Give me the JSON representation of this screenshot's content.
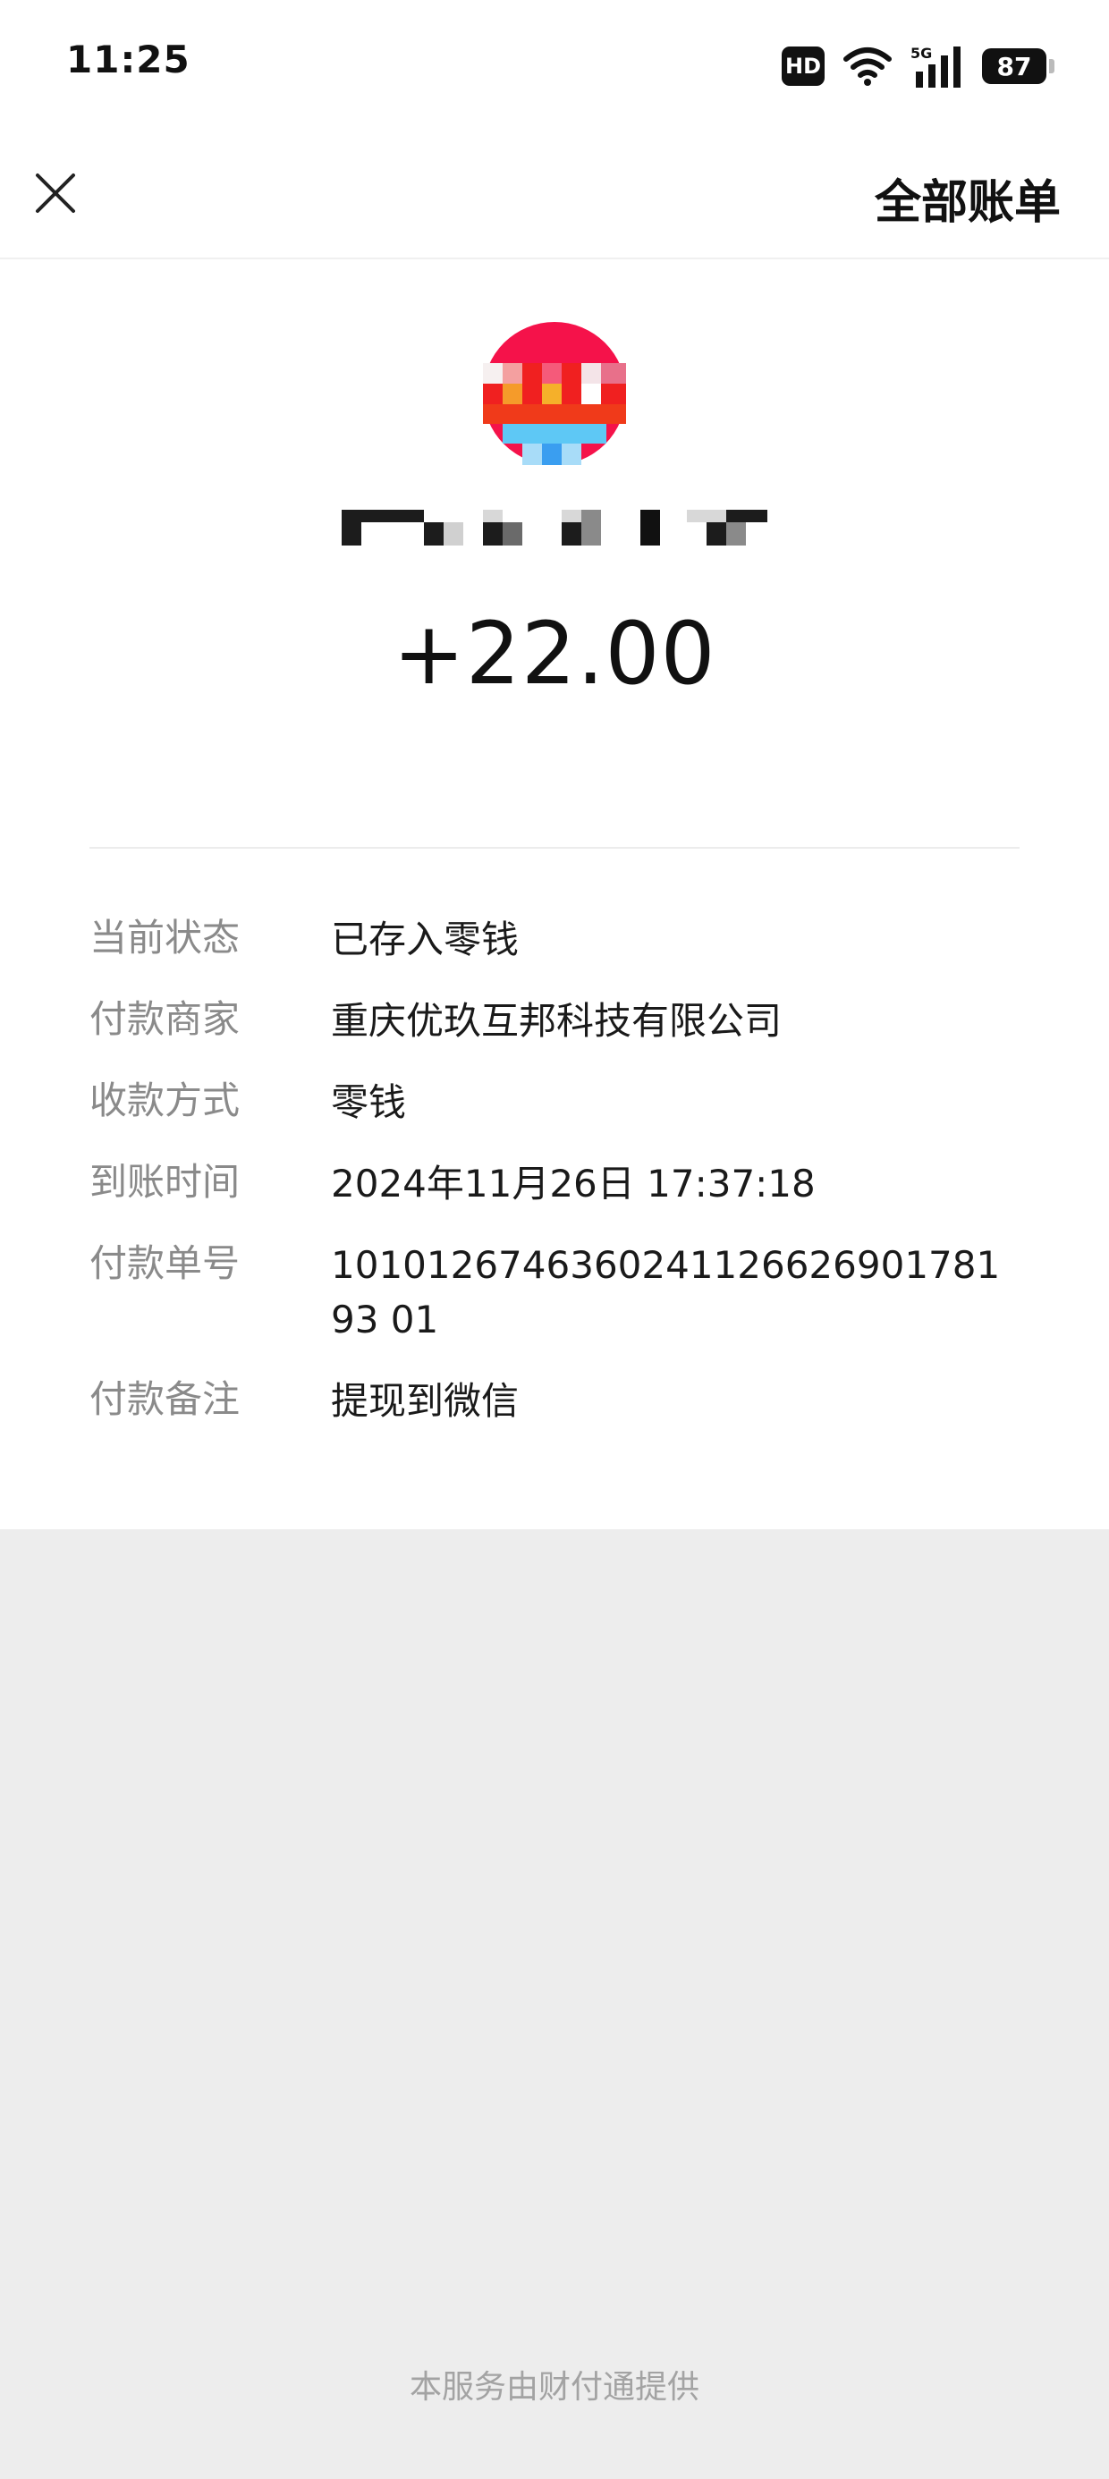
{
  "status_bar": {
    "time": "11:25",
    "hd_label": "HD",
    "network_label": "5G",
    "battery_level": "87"
  },
  "nav": {
    "close_icon": "close-icon",
    "all_bills_label": "全部账单"
  },
  "header": {
    "amount": "+22.00"
  },
  "details": [
    {
      "label": "当前状态",
      "value": "已存入零钱"
    },
    {
      "label": "付款商家",
      "value": "重庆优玖互邦科技有限公司"
    },
    {
      "label": "收款方式",
      "value": "零钱"
    },
    {
      "label": "到账时间",
      "value": "2024年11月26日 17:37:18"
    },
    {
      "label": "付款单号",
      "value": "101012674636024112662690178193 01"
    },
    {
      "label": "付款备注",
      "value": "提现到微信"
    }
  ],
  "footer": {
    "text": "本服务由财付通提供"
  },
  "colors": {
    "background": "#ededed",
    "card": "#ffffff",
    "label_gray": "#8a8a8a",
    "text_dark": "#1a1a1a"
  }
}
